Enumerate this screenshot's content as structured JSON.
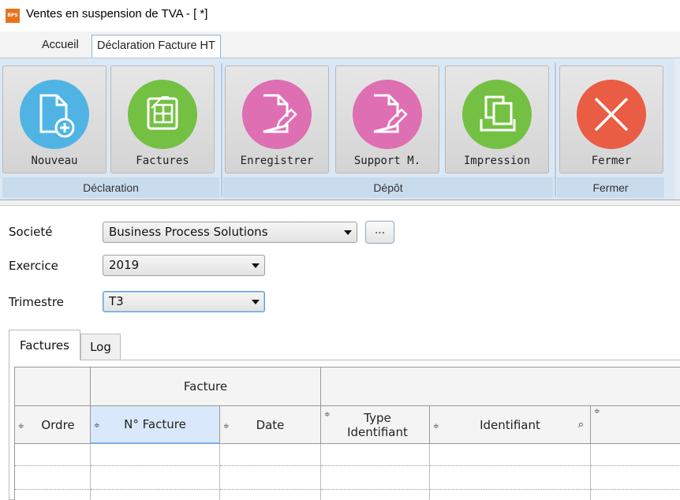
{
  "window": {
    "title": "Ventes en suspension de TVA - [ *]",
    "app_icon_text": "BPS"
  },
  "ribbon": {
    "tabs": [
      {
        "label": "Accueil"
      },
      {
        "label": "Déclaration Facture HT"
      }
    ],
    "buttons": [
      {
        "label": "Nouveau",
        "icon": "new-document-icon",
        "color": "#4fb4e4"
      },
      {
        "label": "Factures",
        "icon": "invoice-grid-icon",
        "color": "#74c043"
      },
      {
        "label": "Enregistrer",
        "icon": "edit-document-icon",
        "color": "#de6fb2"
      },
      {
        "label": "Support M.",
        "icon": "edit-document-icon",
        "color": "#de6fb2"
      },
      {
        "label": "Impression",
        "icon": "printer-icon",
        "color": "#74c043"
      },
      {
        "label": "Fermer",
        "icon": "close-icon",
        "color": "#e95d44"
      }
    ],
    "groups": [
      {
        "label": "Déclaration"
      },
      {
        "label": "Dépôt"
      },
      {
        "label": "Fermer"
      }
    ]
  },
  "form": {
    "societe": {
      "label": "Societé",
      "value": "Business Process Solutions",
      "more": "..."
    },
    "exercice": {
      "label": "Exercice",
      "value": "2019"
    },
    "trimestre": {
      "label": "Trimestre",
      "value": "T3"
    }
  },
  "bottom_tabs": [
    {
      "label": "Factures"
    },
    {
      "label": "Log"
    }
  ],
  "grid": {
    "band": "Facture",
    "columns": [
      {
        "label": "Ordre"
      },
      {
        "label": "N° Facture"
      },
      {
        "label": "Date"
      },
      {
        "label": "Type Identifiant"
      },
      {
        "label": "Identifiant"
      }
    ],
    "sort_glyph": "≑",
    "filter_glyph": "⌕"
  }
}
